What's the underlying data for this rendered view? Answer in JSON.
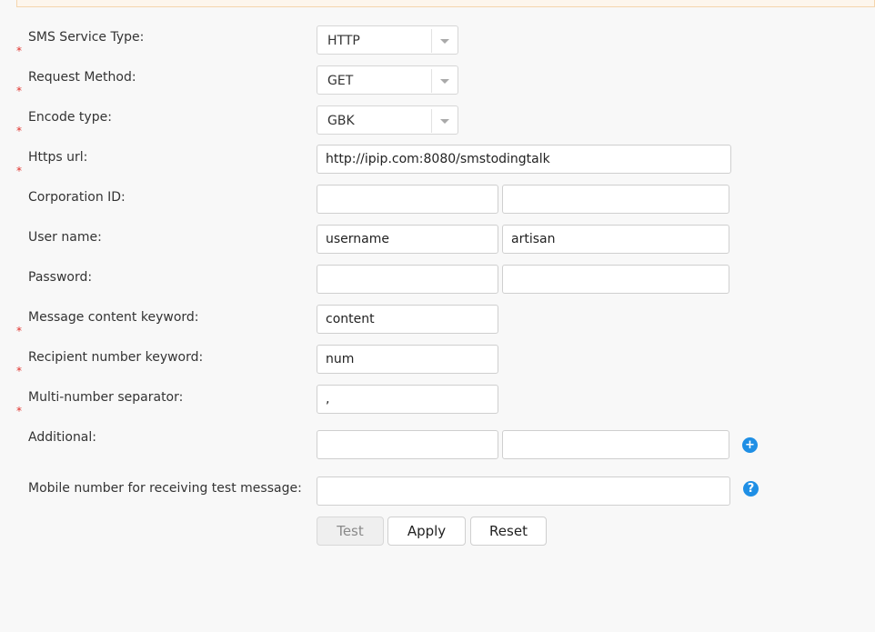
{
  "form": {
    "sms_service_type": {
      "label": "SMS Service Type:",
      "value": "HTTP",
      "required": true
    },
    "request_method": {
      "label": "Request Method:",
      "value": "GET",
      "required": true
    },
    "encode_type": {
      "label": "Encode type:",
      "value": "GBK",
      "required": true
    },
    "https_url": {
      "label": "Https url:",
      "value": "http://ipip.com:8080/smstodingtalk",
      "required": true
    },
    "corporation_id": {
      "label": "Corporation ID:",
      "key": "",
      "value": ""
    },
    "user_name": {
      "label": "User name:",
      "key": "username",
      "value": "artisan"
    },
    "password": {
      "label": "Password:",
      "key": "",
      "value": ""
    },
    "message_keyword": {
      "label": "Message content keyword:",
      "value": "content",
      "required": true
    },
    "recipient_keyword": {
      "label": "Recipient number keyword:",
      "value": "num",
      "required": true
    },
    "separator": {
      "label": "Multi-number separator:",
      "value": ",",
      "required": true
    },
    "additional": {
      "label": "Additional:",
      "key": "",
      "value": ""
    },
    "test_mobile": {
      "label": "Mobile number for receiving test message:",
      "value": ""
    }
  },
  "required_mark": "*",
  "icons": {
    "add": "plus-circle-icon",
    "help": "question-circle-icon"
  },
  "buttons": {
    "test": "Test",
    "apply": "Apply",
    "reset": "Reset"
  },
  "colors": {
    "required": "#e0312b",
    "accent": "#1f8fe5",
    "banner_border": "#f4d5ad"
  }
}
